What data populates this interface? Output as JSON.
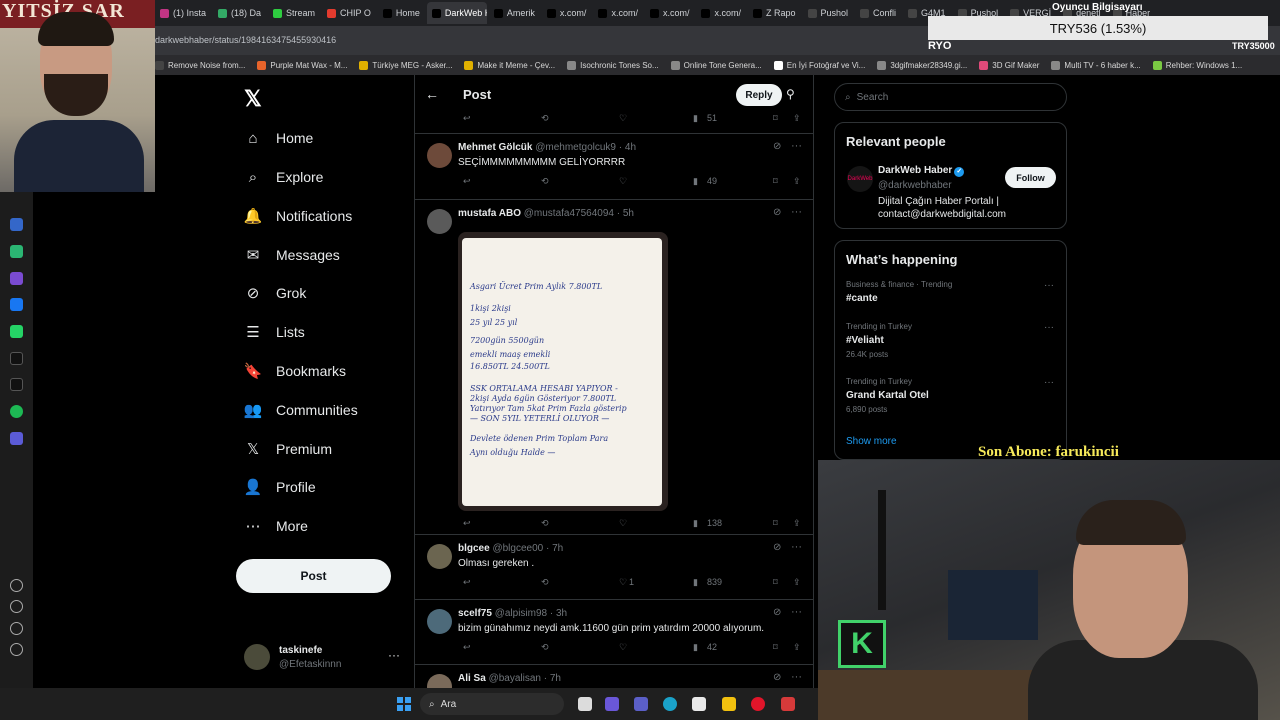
{
  "browser": {
    "tabs": [
      {
        "label": "(1) Insta",
        "color": "#c13584"
      },
      {
        "label": "(18) Da",
        "color": "#33aa66"
      },
      {
        "label": "Stream",
        "color": "#2ecc40"
      },
      {
        "label": "CHIP O",
        "color": "#e33b2e"
      },
      {
        "label": "Home",
        "color": "#000000"
      },
      {
        "label": "DarkWeb Ha",
        "color": "#000000"
      },
      {
        "label": "Amerik",
        "color": "#000000"
      },
      {
        "label": "x.com/",
        "color": "#000000"
      },
      {
        "label": "x.com/",
        "color": "#000000"
      },
      {
        "label": "x.com/",
        "color": "#000000"
      },
      {
        "label": "x.com/",
        "color": "#000000"
      },
      {
        "label": "Z Rapo",
        "color": "#000000"
      },
      {
        "label": "Pushol",
        "color": "#444444"
      },
      {
        "label": "Confli",
        "color": "#444444"
      },
      {
        "label": "G4M1",
        "color": "#444444"
      },
      {
        "label": "Pushol",
        "color": "#444444"
      },
      {
        "label": "VERGİ",
        "color": "#444444"
      },
      {
        "label": "denetl",
        "color": "#444444"
      },
      {
        "label": "Haber",
        "color": "#444444"
      }
    ],
    "url": "darkwebhaber/status/1984163475455930416",
    "bookmarks": [
      {
        "label": "Remove Noise from...",
        "color": "#444444"
      },
      {
        "label": "Purple Mat Wax - M...",
        "color": "#e8642b"
      },
      {
        "label": "Türkiye MEG - Asker...",
        "color": "#e0b000"
      },
      {
        "label": "Make it Meme - Çev...",
        "color": "#e0b000"
      },
      {
        "label": "Isochronic Tones So...",
        "color": "#888888"
      },
      {
        "label": "Online Tone Genera...",
        "color": "#888888"
      },
      {
        "label": "En İyi Fotoğraf ve Vi...",
        "color": "#ffffff"
      },
      {
        "label": "3dgifmaker28349.gi...",
        "color": "#888888"
      },
      {
        "label": "3D Gif Maker",
        "color": "#e04a7a"
      },
      {
        "label": "Multi TV - 6 haber k...",
        "color": "#888888"
      },
      {
        "label": "Rehber: Windows 1...",
        "color": "#7ac943"
      }
    ]
  },
  "overlay": {
    "cam1_banner": "YITSİZ SAR",
    "ticker": "TRY536 (1.53%)",
    "gamertag": "Oyuncu Bilgisayarı",
    "ryo": "RYO",
    "ryo2": "TRY35000",
    "abone": "Son Abone: farukincii",
    "cam2_logo": "K"
  },
  "nav": {
    "logo": "𝕏",
    "items": [
      {
        "icon": "⌂",
        "label": "Home"
      },
      {
        "icon": "⌕",
        "label": "Explore"
      },
      {
        "icon": "🔔",
        "label": "Notifications"
      },
      {
        "icon": "✉",
        "label": "Messages"
      },
      {
        "icon": "⊘",
        "label": "Grok"
      },
      {
        "icon": "☰",
        "label": "Lists"
      },
      {
        "icon": "🔖",
        "label": "Bookmarks"
      },
      {
        "icon": "👥",
        "label": "Communities"
      },
      {
        "icon": "𝕏",
        "label": "Premium"
      },
      {
        "icon": "👤",
        "label": "Profile"
      },
      {
        "icon": "⋯",
        "label": "More"
      }
    ],
    "post_button": "Post",
    "account": {
      "name": "taskinefe",
      "handle": "@Efetaskinnn",
      "menu": "···"
    }
  },
  "post_header": {
    "back": "←",
    "title": "Post",
    "reply": "Reply",
    "filter": "⚲"
  },
  "first_actions": {
    "views": "51"
  },
  "tweets": [
    {
      "name": "Mehmet Gölcük",
      "meta": "@mehmetgolcuk9 · 4h",
      "text": "SEÇİMMMMMMMMM GELİYORRRR",
      "likes": "",
      "views": "49",
      "avatar": "#6d4a3a"
    },
    {
      "name": "mustafa ABO",
      "meta": "@mustafa47564094 · 5h",
      "text": "",
      "likes": "",
      "views": "138",
      "avatar": "#5a5a5a"
    },
    {
      "name": "blgcee",
      "meta": "@blgcee00 · 7h",
      "text": "Olması gereken .",
      "likes": "1",
      "views": "839",
      "avatar": "#6b6550"
    },
    {
      "name": "scelf75",
      "meta": "@alpisim98 · 3h",
      "text": "bizim günahımız neydi amk.11600 gün prim yatırdım 20000 alıyorum.",
      "likes": "",
      "views": "42",
      "avatar": "#4d6a7a"
    },
    {
      "name": "Ali Sa",
      "meta": "@bayalisan · 7h",
      "text": "",
      "likes": "",
      "views": "",
      "avatar": "#7a6a5a"
    }
  ],
  "note_lines": [
    "Asgari Ücret Prim Aylık 7.800TL",
    "1kişi                       2kişi",
    "25 yıl                      25 yıl",
    "7200gün                 5500gün",
    "emekli maaş             emekli",
    "16.850TL                  24.500TL",
    "SSK ORTALAMA HESABI YAPIYOR -",
    "2kişi Ayda 6gün Gösteriyor 7.800TL",
    "Yatırıyor Tam 5kat Prim Fazla gösterip",
    "— SON 5YIL YETERLİ OLUYOR —",
    "Devlete ödenen Prim Toplam Para",
    "Aynı olduğu Halde —"
  ],
  "right": {
    "search_placeholder": "Search",
    "relevant": {
      "heading": "Relevant people",
      "name": "DarkWeb Haber",
      "handle": "@darkwebhaber",
      "bio1": "Dijital Çağın Haber Portalı |",
      "bio2": "contact@darkwebdigital.com",
      "follow": "Follow",
      "avatar_text": "DarkWeb"
    },
    "trends_heading": "What’s happening",
    "trends": [
      {
        "context": "Business & finance · Trending",
        "topic": "#cante",
        "posts": ""
      },
      {
        "context": "Trending in Turkey",
        "topic": "#Veliaht",
        "posts": "26.4K posts"
      },
      {
        "context": "Trending in Turkey",
        "topic": "Grand Kartal Otel",
        "posts": "6,890 posts"
      }
    ],
    "show_more": "Show more"
  },
  "taskbar": {
    "search": "Ara"
  },
  "colors": {
    "accent": "#1d9bf0",
    "bg": "#000000",
    "border": "#2f3336",
    "muted": "#71767b"
  }
}
